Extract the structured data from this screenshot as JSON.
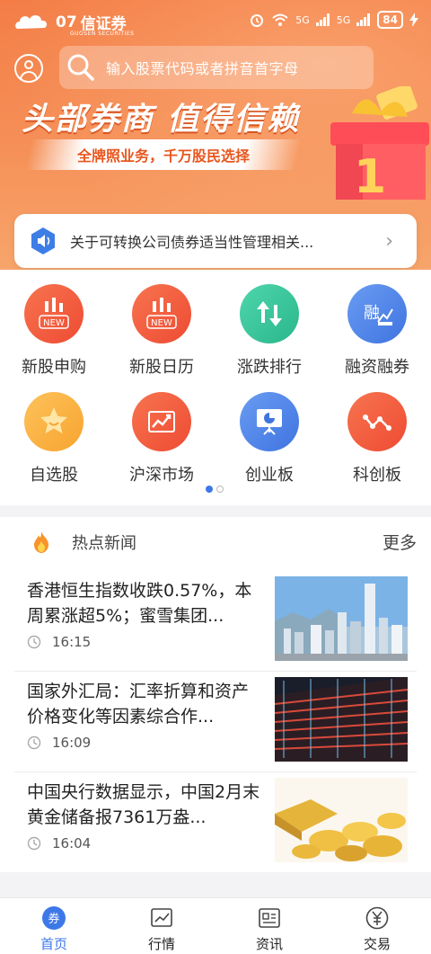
{
  "status": {
    "brand": "信证券",
    "brand_prefix": "07",
    "brand_sub": "GUOSEN SECURITIES",
    "battery": "84",
    "signal1": "5G",
    "signal2": "5G"
  },
  "search": {
    "placeholder": "输入股票代码或者拼音首字母"
  },
  "banner": {
    "title": "头部券商 值得信赖",
    "subtitle": "全牌照业务，千万股民选择"
  },
  "notice": {
    "text": "关于可转换公司债券适当性管理相关..."
  },
  "menu": {
    "items": [
      {
        "label": "新股申购",
        "badge": "NEW",
        "color": "#f15b3e"
      },
      {
        "label": "新股日历",
        "badge": "NEW",
        "color": "#f15b3e"
      },
      {
        "label": "涨跌排行",
        "color": "#38c49a"
      },
      {
        "label": "融资融券",
        "color": "#4a84ec"
      },
      {
        "label": "自选股",
        "color": "#fbae3f"
      },
      {
        "label": "沪深市场",
        "color": "#f15b3e"
      },
      {
        "label": "创业板",
        "color": "#4a84ec"
      },
      {
        "label": "科创板",
        "color": "#f15b3e"
      }
    ]
  },
  "news": {
    "header": "热点新闻",
    "more": "更多",
    "items": [
      {
        "title": "香港恒生指数收跌0.57%，本周累涨超5%；蜜雪集团...",
        "time": "16:15"
      },
      {
        "title": "国家外汇局：汇率折算和资产价格变化等因素综合作...",
        "time": "16:09"
      },
      {
        "title": "中国央行数据显示，中国2月末黄金储备报7361万盎...",
        "time": "16:04"
      }
    ]
  },
  "tabs": [
    {
      "label": "首页",
      "icon": "coupon-icon",
      "active": true
    },
    {
      "label": "行情",
      "icon": "chart-icon"
    },
    {
      "label": "资讯",
      "icon": "news-icon"
    },
    {
      "label": "交易",
      "icon": "yuan-icon"
    }
  ],
  "colors": {
    "brand_orange": "#f47d46",
    "active_blue": "#3d78e8"
  }
}
